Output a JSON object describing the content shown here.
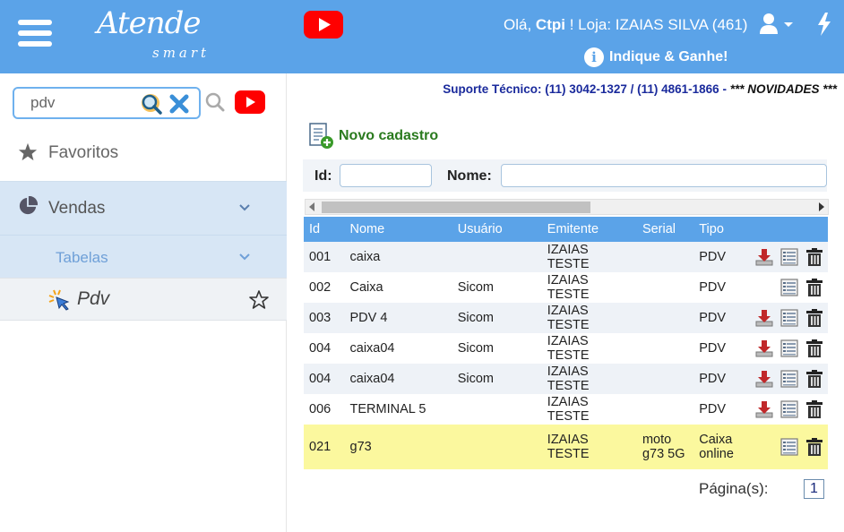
{
  "header": {
    "logo_main": "Atende",
    "logo_sub": "smart",
    "greeting_prefix": "Olá,",
    "user": "Ctpi",
    "greeting_suffix": "!",
    "store": "Loja: IZAIAS SILVA (461)",
    "indique": "Indique & Ganhe!"
  },
  "colors": {
    "accent": "#5ba3e8",
    "youtube": "#ff0000",
    "highlight_row": "#fbf89e",
    "novo_green": "#2a7a1e"
  },
  "sidebar": {
    "search_value": "pdv",
    "favoritos": "Favoritos",
    "vendas": "Vendas",
    "tabelas": "Tabelas",
    "pdv": "Pdv"
  },
  "main": {
    "support_text": "Suporte Técnico: (11) 3042-1327 / (11) 4861-1866 - ",
    "news": "*** NOVIDADES ***",
    "novo_cadastro": "Novo cadastro",
    "filter_id_label": "Id:",
    "filter_id_value": "",
    "filter_name_label": "Nome:",
    "filter_name_value": "",
    "columns": [
      "Id",
      "Nome",
      "Usuário",
      "Emitente",
      "Serial",
      "Tipo"
    ],
    "rows": [
      {
        "id": "001",
        "nome": "caixa",
        "usuario": "",
        "emitente": "IZAIAS TESTE",
        "serial": "",
        "tipo": "PDV",
        "download": true
      },
      {
        "id": "002",
        "nome": "Caixa",
        "usuario": "Sicom",
        "emitente": "IZAIAS TESTE",
        "serial": "",
        "tipo": "PDV",
        "download": false
      },
      {
        "id": "003",
        "nome": "PDV 4",
        "usuario": "Sicom",
        "emitente": "IZAIAS TESTE",
        "serial": "",
        "tipo": "PDV",
        "download": true
      },
      {
        "id": "004",
        "nome": "caixa04",
        "usuario": "Sicom",
        "emitente": "IZAIAS TESTE",
        "serial": "",
        "tipo": "PDV",
        "download": true
      },
      {
        "id": "004",
        "nome": "caixa04",
        "usuario": "Sicom",
        "emitente": "IZAIAS TESTE",
        "serial": "",
        "tipo": "PDV",
        "download": true
      },
      {
        "id": "006",
        "nome": "TERMINAL 5",
        "usuario": "",
        "emitente": "IZAIAS TESTE",
        "serial": "",
        "tipo": "PDV",
        "download": true
      },
      {
        "id": "021",
        "nome": "g73",
        "usuario": "",
        "emitente": "IZAIAS TESTE",
        "serial": "moto g73 5G",
        "tipo": "Caixa online",
        "download": false
      }
    ],
    "paging_label": "Página(s):",
    "page": "1"
  },
  "icons": {
    "menu": "hamburger-icon",
    "youtube": "youtube-icon",
    "user": "user-icon",
    "bolt": "bolt-icon",
    "info": "info-icon",
    "search": "search-icon",
    "clear": "close-icon",
    "star": "star-icon",
    "pie": "pie-chart-icon",
    "chevron": "chevron-down-icon",
    "click": "click-icon",
    "download": "download-icon",
    "list": "list-icon",
    "trash": "trash-icon",
    "new": "new-document-icon"
  }
}
